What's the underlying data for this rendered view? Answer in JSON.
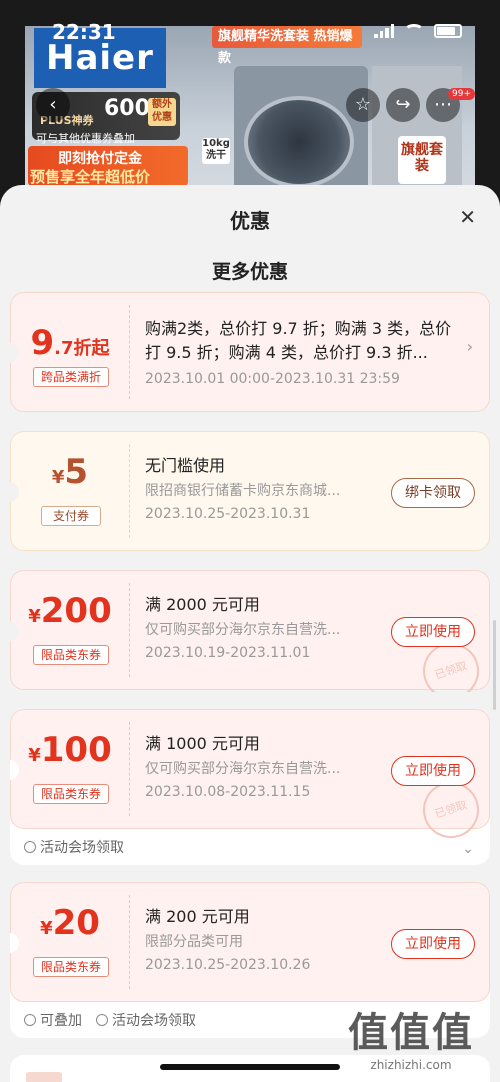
{
  "status": {
    "time": "22:31"
  },
  "banner": {
    "brand": "Haier",
    "promo_top": "旗舰精华洗套装 热销爆款",
    "plus_label": "PLUS神券",
    "plus_amount": "600",
    "plus_tag": "额外优惠",
    "plus_sub": "可与其他优惠券叠加",
    "presale_line1": "即刻抢付定金",
    "presale_line2": "预售享全年超低价",
    "kg_tag": "10kg 洗干",
    "flag_tag": "旗舰套装",
    "cart_badge": "99+"
  },
  "sheet": {
    "title": "优惠",
    "close_icon": "close-icon",
    "section_title": "更多优惠"
  },
  "coupons": [
    {
      "style": "red",
      "value_big": "9",
      "value_small": ".7折起",
      "tag": "跨品类满折",
      "title": "购满2类，总价打 9.7 折；购满 3 类，总价打 9.5 折；购满 4 类，总价打 9.3 折...",
      "date": "2023.10.01 00:00-2023.10.31 23:59"
    },
    {
      "style": "cream",
      "currency": "¥",
      "value_big": "5",
      "tag": "支付券",
      "title": "无门槛使用",
      "desc": "限招商银行储蓄卡购京东商城...",
      "date": "2023.10.25-2023.10.31",
      "button": "绑卡领取"
    },
    {
      "style": "red",
      "currency": "¥",
      "value_big": "200",
      "tag": "限品类东券",
      "title": "满 2000 元可用",
      "desc": "仅可购买部分海尔京东自营洗...",
      "date": "2023.10.19-2023.11.01",
      "button": "立即使用",
      "stamp": "已领取"
    },
    {
      "style": "red",
      "currency": "¥",
      "value_big": "100",
      "tag": "限品类东券",
      "title": "满 1000 元可用",
      "desc": "仅可购买部分海尔京东自营洗...",
      "date": "2023.10.08-2023.11.15",
      "button": "立即使用",
      "stamp": "已领取",
      "footer": "活动会场领取"
    },
    {
      "style": "red",
      "currency": "¥",
      "value_big": "20",
      "tag": "限品类东券",
      "title": "满 200 元可用",
      "desc": "限部分品类可用",
      "date": "2023.10.25-2023.10.26",
      "button": "立即使用",
      "footer_a": "可叠加",
      "footer_b": "活动会场领取"
    }
  ],
  "watermark": {
    "big": "值值值",
    "small": "zhizhizhi.com"
  }
}
